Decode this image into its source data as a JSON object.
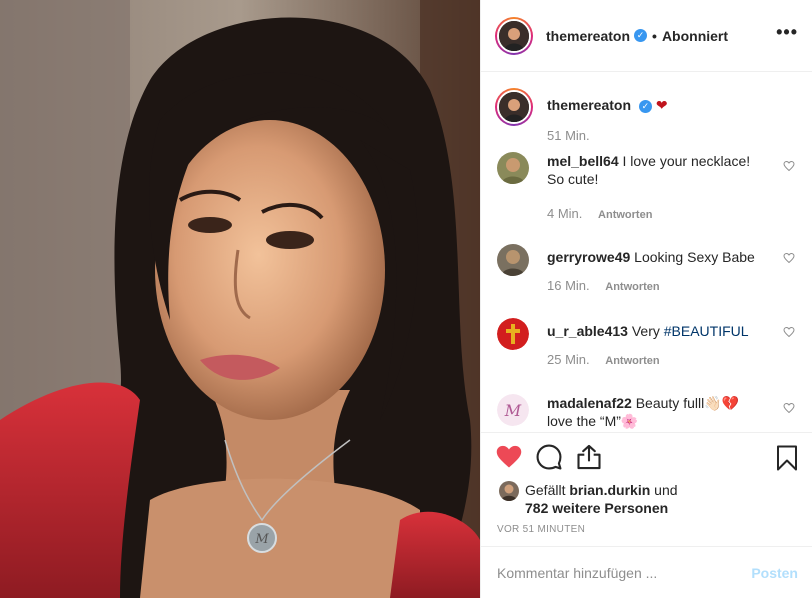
{
  "colors": {
    "accent": "#3897f0",
    "like_red": "#ed4956",
    "muted": "#8e8e8e",
    "post_button": "#b2dffc",
    "hashtag": "#003569"
  },
  "header": {
    "username": "themereaton",
    "separator": "•",
    "follow_state": "Abonniert",
    "more_icon": "more-horizontal-icon"
  },
  "caption": {
    "username": "themereaton",
    "emoji": "❤",
    "time": "51 Min."
  },
  "comments": [
    {
      "username": "mel_bell64",
      "text": "I love your necklace! So cute!",
      "time": "4 Min.",
      "reply": "Antworten"
    },
    {
      "username": "gerryrowe49",
      "text": "Looking Sexy Babe",
      "time": "16 Min.",
      "reply": "Antworten"
    },
    {
      "username": "u_r_able413",
      "text": "Very ",
      "hashtag": "#BEAUTIFUL",
      "time": "25 Min.",
      "reply": "Antworten"
    },
    {
      "username": "madalenaf22",
      "text": "Beauty fulll👋🏻💔 love the “M”🌸"
    }
  ],
  "actions": {
    "liked_icon": "heart-filled-icon",
    "comment_icon": "comment-icon",
    "share_icon": "share-icon",
    "save_icon": "bookmark-icon"
  },
  "likes": {
    "prefix": "Gefällt",
    "user": "brian.durkin",
    "middle": "und",
    "others": "782 weitere Personen"
  },
  "time_ago": "VOR 51 MINUTEN",
  "add_comment": {
    "placeholder": "Kommentar hinzufügen ...",
    "post_label": "Posten"
  }
}
